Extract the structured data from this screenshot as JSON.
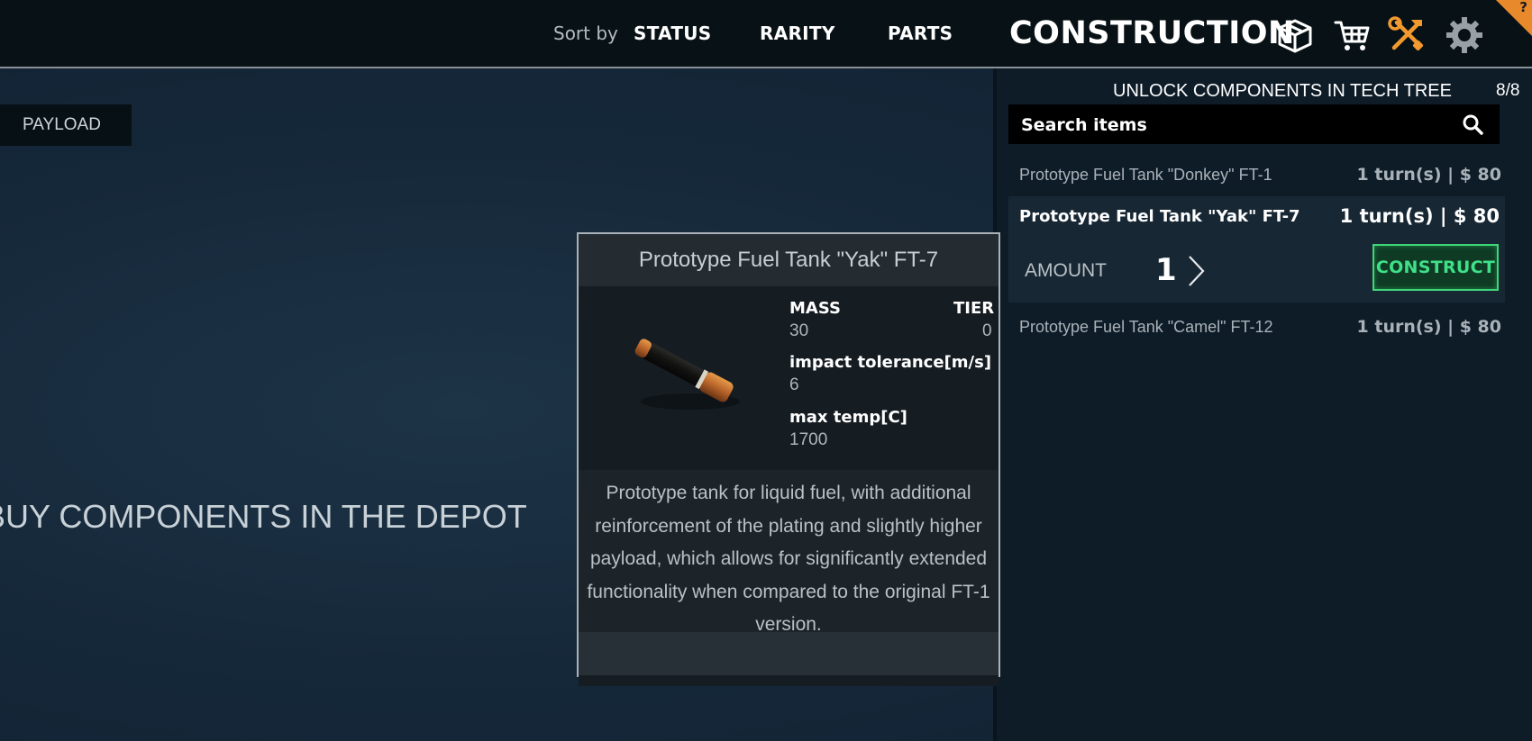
{
  "header": {
    "sort_label": "Sort by",
    "sort_options": [
      "STATUS",
      "RARITY",
      "PARTS"
    ],
    "title": "CONSTRUCTION",
    "nav_icons": [
      "box-icon",
      "cart-icon",
      "tools-icon",
      "gear-icon"
    ],
    "active_icon_color": "#f39a2e",
    "help": "?"
  },
  "left": {
    "tab_label": "PAYLOAD",
    "message": "BUY COMPONENTS IN THE DEPOT"
  },
  "panel": {
    "title": "UNLOCK COMPONENTS IN TECH TREE",
    "counter": "8/8",
    "search_placeholder": "Search items",
    "items": [
      {
        "name": "Prototype Fuel Tank \"Donkey\" FT-1",
        "price": "1 turn(s) | $ 80"
      },
      {
        "name": "Prototype Fuel Tank \"Yak\" FT-7",
        "price": "1 turn(s) | $ 80"
      },
      {
        "name": "Prototype Fuel Tank \"Camel\" FT-12",
        "price": "1 turn(s) | $ 80"
      }
    ],
    "selected": {
      "amount_label": "AMOUNT",
      "amount": "1",
      "construct_label": "CONSTRUCT"
    }
  },
  "card": {
    "title": "Prototype Fuel Tank \"Yak\" FT-7",
    "stats": {
      "mass_label": "MASS",
      "mass": "30",
      "tier_label": "TIER",
      "tier": "0",
      "impact_label": "impact tolerance[m/s]",
      "impact": "6",
      "temp_label": "max temp[C]",
      "temp": "1700"
    },
    "description": "Prototype tank for liquid fuel, with additional reinforcement of the plating and slightly higher payload, which allows for significantly extended functionality when compared to the original FT-1 version."
  }
}
